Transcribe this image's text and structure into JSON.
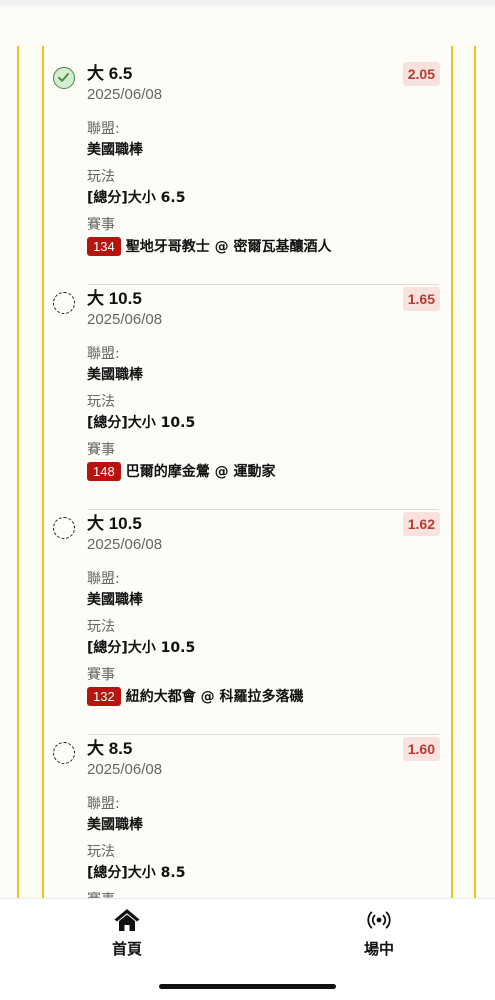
{
  "bets": [
    {
      "status": "won",
      "title": "大 6.5",
      "date": "2025/06/08",
      "odds": "2.05",
      "league_label": "聯盟:",
      "league_value": "美國職棒",
      "market_label": "玩法",
      "market_value": "[總分]大小 6.5",
      "event_label": "賽事",
      "game_code": "134",
      "game_name": "聖地牙哥教士 @ 密爾瓦基釀酒人"
    },
    {
      "status": "pending",
      "title": "大 10.5",
      "date": "2025/06/08",
      "odds": "1.65",
      "league_label": "聯盟:",
      "league_value": "美國職棒",
      "market_label": "玩法",
      "market_value": "[總分]大小 10.5",
      "event_label": "賽事",
      "game_code": "148",
      "game_name": "巴爾的摩金鶯 @ 運動家"
    },
    {
      "status": "pending",
      "title": "大 10.5",
      "date": "2025/06/08",
      "odds": "1.62",
      "league_label": "聯盟:",
      "league_value": "美國職棒",
      "market_label": "玩法",
      "market_value": "[總分]大小 10.5",
      "event_label": "賽事",
      "game_code": "132",
      "game_name": "紐約大都會 @ 科羅拉多落磯"
    },
    {
      "status": "pending",
      "title": "大 8.5",
      "date": "2025/06/08",
      "odds": "1.60",
      "league_label": "聯盟:",
      "league_value": "美國職棒",
      "market_label": "玩法",
      "market_value": "[總分]大小 8.5",
      "event_label": "賽事",
      "game_code": "",
      "game_name": ""
    }
  ],
  "tabbar": {
    "home_label": "首頁",
    "home_icon": "home-icon",
    "live_label": "場中",
    "live_icon": "broadcast-icon"
  },
  "colors": {
    "gold_rail": "#f2c21b",
    "odds_text": "#b93a32",
    "odds_bg": "#f7e2dd",
    "game_code_bg": "#b8140f",
    "won_green": "#3f8a3a"
  }
}
